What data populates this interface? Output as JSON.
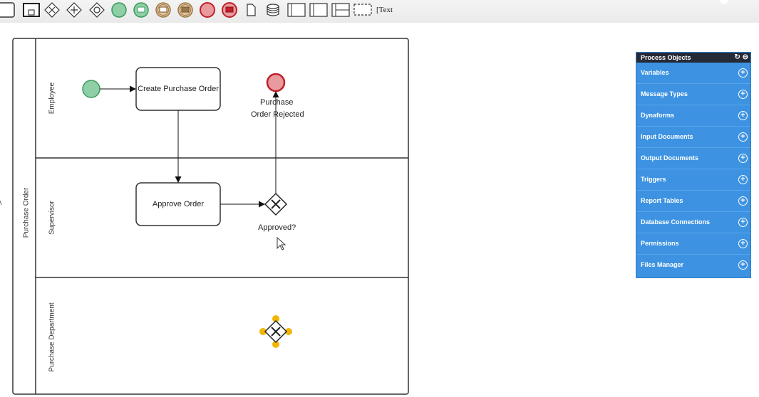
{
  "toolbar": {
    "text_tool_label": "Text"
  },
  "pool": {
    "name": "Purchase Order",
    "lanes": [
      "Employee",
      "Supervisor",
      "Purchase Department"
    ]
  },
  "tasks": {
    "create_po": "Create Purchase Order",
    "approve": "Approve Order"
  },
  "events": {
    "end_line1": "Purchase",
    "end_line2": "Order Rejected"
  },
  "gateways": {
    "approved": "Approved?"
  },
  "panel": {
    "title": "Process Objects",
    "refresh_icon": "↻",
    "collapse_icon": "⊖",
    "items": [
      {
        "label": "Variables"
      },
      {
        "label": "Message Types"
      },
      {
        "label": "Dynaforms"
      },
      {
        "label": "Input Documents"
      },
      {
        "label": "Output Documents"
      },
      {
        "label": "Triggers"
      },
      {
        "label": "Report Tables"
      },
      {
        "label": "Database Connections"
      },
      {
        "label": "Permissions"
      },
      {
        "label": "Files Manager"
      }
    ]
  },
  "colors": {
    "start_fill": "#8fcfa6",
    "start_stroke": "#3a9a5e",
    "end_fill": "#e89a9e",
    "end_stroke": "#c0202a",
    "selected_handles": "#f2b600",
    "panel_bg": "#3d93e2"
  }
}
